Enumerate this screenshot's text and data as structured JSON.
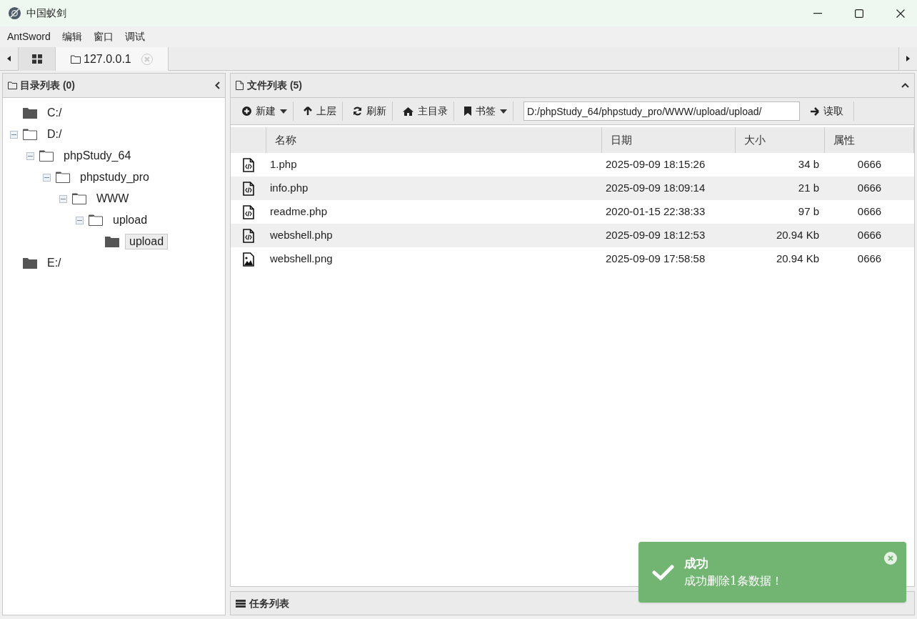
{
  "window": {
    "title": "中国蚁剑"
  },
  "menu": [
    "AntSword",
    "编辑",
    "窗口",
    "调试"
  ],
  "tabs": [
    {
      "kind": "home",
      "selected": false
    },
    {
      "kind": "folder",
      "label": "127.0.0.1",
      "selected": true
    }
  ],
  "tree_panel": {
    "title": "目录列表 (0)",
    "items": [
      {
        "label": "C:/",
        "expanded": false,
        "selected": false
      },
      {
        "label": "D:/",
        "expanded": true,
        "selected": false,
        "children": [
          {
            "label": "phpStudy_64",
            "expanded": true,
            "selected": false,
            "children": [
              {
                "label": "phpstudy_pro",
                "expanded": true,
                "selected": false,
                "children": [
                  {
                    "label": "WWW",
                    "expanded": true,
                    "selected": false,
                    "children": [
                      {
                        "label": "upload",
                        "expanded": true,
                        "selected": false,
                        "children": [
                          {
                            "label": "upload",
                            "expanded": false,
                            "selected": true
                          }
                        ]
                      }
                    ]
                  }
                ]
              }
            ]
          }
        ]
      },
      {
        "label": "E:/",
        "expanded": false,
        "selected": false
      }
    ]
  },
  "file_panel": {
    "title": "文件列表 (5)",
    "toolbar": [
      {
        "kind": "plus",
        "label": "新建",
        "dropdown": true
      },
      {
        "kind": "up",
        "label": "上层",
        "dropdown": false
      },
      {
        "kind": "refresh",
        "label": "刷新",
        "dropdown": false
      },
      {
        "kind": "home",
        "label": "主目录",
        "dropdown": false
      },
      {
        "kind": "bookmark",
        "label": "书签",
        "dropdown": true
      }
    ],
    "path": "D:/phpStudy_64/phpstudy_pro/WWW/upload/upload/",
    "read_button": "读取",
    "table": {
      "columns": [
        "名称",
        "日期",
        "大小",
        "属性"
      ],
      "rows": [
        {
          "kind": "code",
          "name": "1.php",
          "date": "2025-09-09 18:15:26",
          "size": "34 b",
          "attr": "0666"
        },
        {
          "kind": "code",
          "name": "info.php",
          "date": "2025-09-09 18:09:14",
          "size": "21 b",
          "attr": "0666"
        },
        {
          "kind": "code",
          "name": "readme.php",
          "date": "2020-01-15 22:38:33",
          "size": "97 b",
          "attr": "0666"
        },
        {
          "kind": "code",
          "name": "webshell.php",
          "date": "2025-09-09 18:12:53",
          "size": "20.94 Kb",
          "attr": "0666"
        },
        {
          "kind": "image",
          "name": "webshell.png",
          "date": "2025-09-09 17:58:58",
          "size": "20.94 Kb",
          "attr": "0666"
        }
      ]
    }
  },
  "task_panel": {
    "title": "任务列表"
  },
  "toast": {
    "title": "成功",
    "message": "成功删除1条数据！"
  }
}
